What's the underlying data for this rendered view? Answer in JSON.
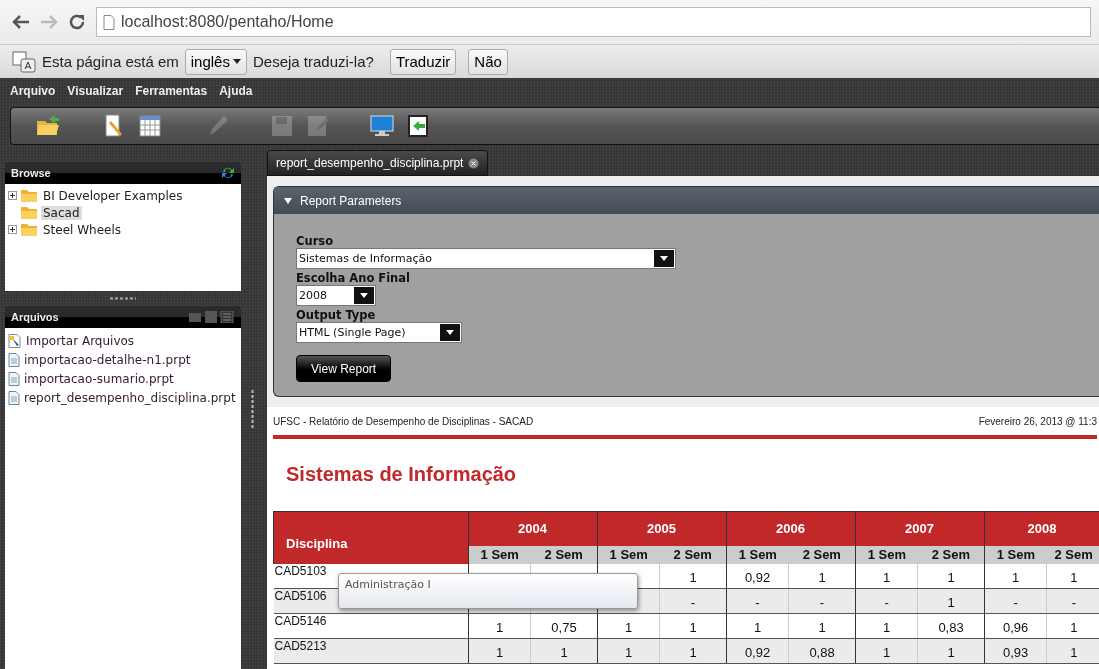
{
  "browser": {
    "url": "localhost:8080/pentaho/Home"
  },
  "translate_bar": {
    "message": "Esta página está em",
    "language": "inglês",
    "question": "Deseja traduzi-la?",
    "buttons": [
      "Traduzir",
      "Não"
    ]
  },
  "menu": [
    "Arquivo",
    "Visualizar",
    "Ferramentas",
    "Ajuda"
  ],
  "toolbar": [
    {
      "kind": "open",
      "disabled": false
    },
    {
      "kind": "new-report",
      "disabled": false
    },
    {
      "kind": "calendar",
      "disabled": false
    },
    {
      "kind": "edit",
      "disabled": true
    },
    {
      "kind": "save",
      "disabled": true
    },
    {
      "kind": "save-as",
      "disabled": true
    },
    {
      "kind": "monitor",
      "disabled": false
    },
    {
      "kind": "exit",
      "disabled": false
    }
  ],
  "browse": {
    "title": "Browse",
    "tree": [
      {
        "label": "BI Developer Examples",
        "kind": "expandable",
        "selected": false
      },
      {
        "label": "Sacad",
        "kind": "leaf",
        "selected": true
      },
      {
        "label": "Steel Wheels",
        "kind": "expandable",
        "selected": false
      }
    ]
  },
  "files": {
    "title": "Arquivos",
    "items": [
      {
        "kind": "import",
        "label": "Importar Arquivos"
      },
      {
        "kind": "file",
        "label": "importacao-detalhe-n1.prpt"
      },
      {
        "kind": "file",
        "label": "importacao-sumario.prpt"
      },
      {
        "kind": "file",
        "label": "report_desempenho_disciplina.prpt"
      }
    ]
  },
  "tabs": [
    {
      "label": "report_desempenho_disciplina.prpt",
      "selected": true
    }
  ],
  "parameters": {
    "title": "Report Parameters",
    "expanded": true,
    "fields": [
      {
        "label": "Curso",
        "value": "Sistemas de Informação",
        "kind": "wide"
      },
      {
        "label": "Escolha Ano Final",
        "value": "2008",
        "kind": "short"
      },
      {
        "label": "Output Type",
        "value": "HTML (Single Page)",
        "kind": "medium"
      }
    ],
    "button": "View Report"
  },
  "report": {
    "header_left": "UFSC - Relatório de Desempenho de Disciplinas - SACAD",
    "header_right": "Fevereiro 26, 2013 @ 11:3",
    "title": "Sistemas de Informação",
    "table": {
      "first_column": "Disciplina",
      "years": [
        "2004",
        "2005",
        "2006",
        "2007",
        "2008"
      ],
      "sub_columns": [
        "1 Sem",
        "2 Sem",
        "1 Sem",
        "2 Sem",
        "1 Sem",
        "2 Sem",
        "1 Sem",
        "2 Sem",
        "1 Sem",
        "2 Sem"
      ],
      "rows": [
        {
          "code": "CAD5103",
          "cells": [
            null,
            null,
            null,
            "1",
            "0,92",
            "1",
            "1",
            "1",
            "1",
            "1"
          ]
        },
        {
          "code": "CAD5106",
          "cells": [
            null,
            null,
            null,
            "-",
            "-",
            "-",
            "-",
            "1",
            "-",
            "-"
          ]
        },
        {
          "code": "CAD5146",
          "cells": [
            "1",
            "0,75",
            "1",
            "1",
            "1",
            "1",
            "1",
            "0,83",
            "0,96",
            "1"
          ]
        },
        {
          "code": "CAD5213",
          "cells": [
            "1",
            "1",
            "1",
            "1",
            "0,92",
            "0,88",
            "1",
            "1",
            "0,93",
            "1"
          ]
        }
      ]
    },
    "tooltip": "Administração I"
  }
}
